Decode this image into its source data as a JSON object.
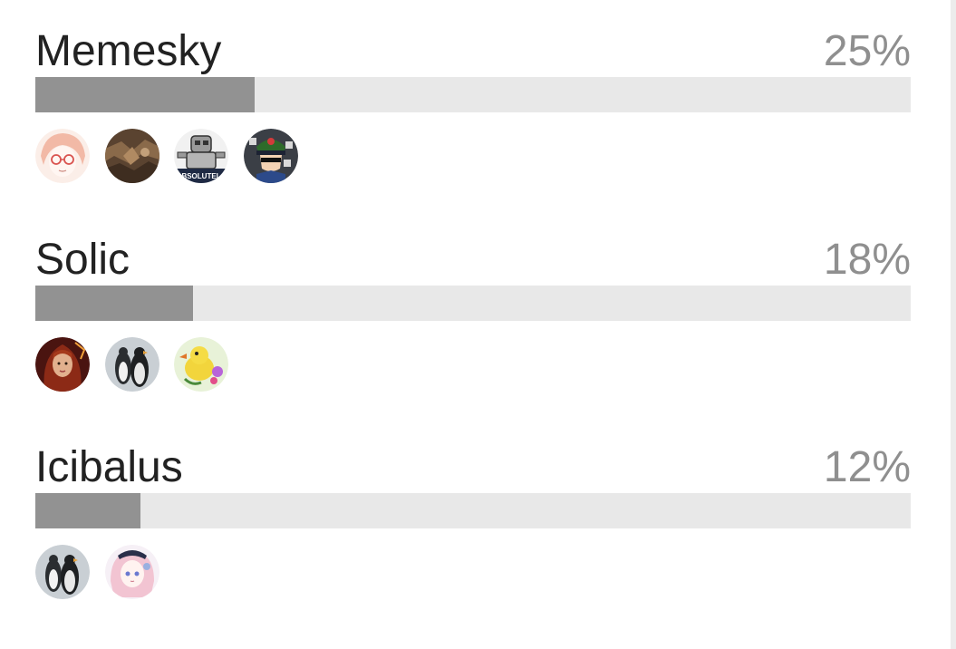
{
  "poll": {
    "options": [
      {
        "label": "Memesky",
        "percent_text": "25%",
        "fraction": 0.25,
        "voters": [
          {
            "name": "anime-girl-glasses-avatar"
          },
          {
            "name": "brown-texture-avatar"
          },
          {
            "name": "absolutely-robot-avatar",
            "badge_text": "BSOLUTEL"
          },
          {
            "name": "cartoon-captain-avatar"
          }
        ]
      },
      {
        "label": "Solic",
        "percent_text": "18%",
        "fraction": 0.18,
        "voters": [
          {
            "name": "red-hair-woman-avatar"
          },
          {
            "name": "penguins-avatar"
          },
          {
            "name": "yellow-bird-avatar"
          }
        ]
      },
      {
        "label": "Icibalus",
        "percent_text": "12%",
        "fraction": 0.12,
        "voters": [
          {
            "name": "penguins-avatar"
          },
          {
            "name": "pink-hair-anime-avatar"
          }
        ]
      }
    ]
  },
  "colors": {
    "label": "#222222",
    "percent": "#8f8f8f",
    "bar_track": "#e8e8e8",
    "bar_fill": "#929292"
  }
}
